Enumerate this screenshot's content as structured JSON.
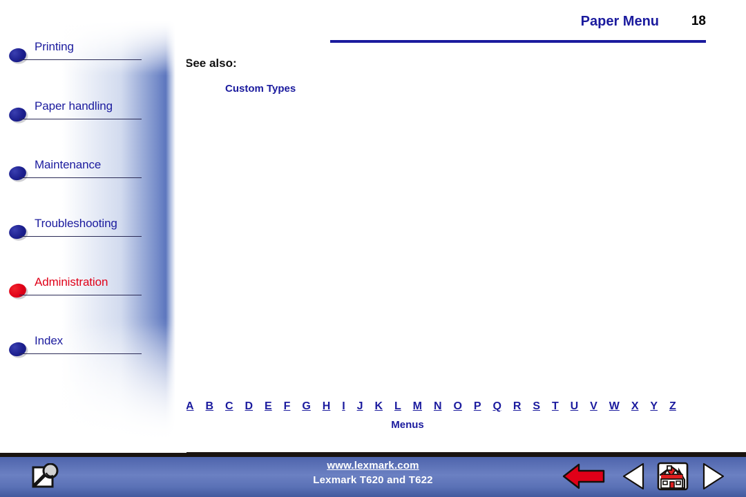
{
  "header": {
    "title": "Paper Menu",
    "page_number": "18",
    "rule_color": "#1b1b9e"
  },
  "sidebar": {
    "items": [
      {
        "label": "Printing",
        "bullet": "oval-bullet-icon",
        "state": "normal"
      },
      {
        "label": "Paper handling",
        "bullet": "oval-bullet-icon",
        "state": "normal"
      },
      {
        "label": "Maintenance",
        "bullet": "oval-bullet-icon",
        "state": "normal"
      },
      {
        "label": "Troubleshooting",
        "bullet": "oval-bullet-icon",
        "state": "normal"
      },
      {
        "label": "Administration",
        "bullet": "oval-bullet-icon",
        "state": "active"
      },
      {
        "label": "Index",
        "bullet": "oval-bullet-icon",
        "state": "normal"
      }
    ],
    "normal_color": "#1b1b9e",
    "active_color": "#e00018"
  },
  "main": {
    "see_also_label": "See also:",
    "see_also_links": [
      "Custom Types"
    ]
  },
  "alpha_index": {
    "letters": [
      "A",
      "B",
      "C",
      "D",
      "E",
      "F",
      "G",
      "H",
      "I",
      "J",
      "K",
      "L",
      "M",
      "N",
      "O",
      "P",
      "Q",
      "R",
      "S",
      "T",
      "U",
      "V",
      "W",
      "X",
      "Y",
      "Z"
    ],
    "caption": "Menus"
  },
  "footer": {
    "search_icon": "magnifier-page-icon",
    "url": "www.lexmark.com",
    "model": "Lexmark T620 and T622",
    "buttons": [
      {
        "name": "back-button",
        "icon": "red-left-arrow-icon"
      },
      {
        "name": "previous-button",
        "icon": "white-left-triangle-icon"
      },
      {
        "name": "home-button",
        "icon": "house-icon"
      },
      {
        "name": "next-button",
        "icon": "white-right-triangle-icon"
      }
    ],
    "band_color": "#5a71b6",
    "accent_color": "#e00018"
  }
}
